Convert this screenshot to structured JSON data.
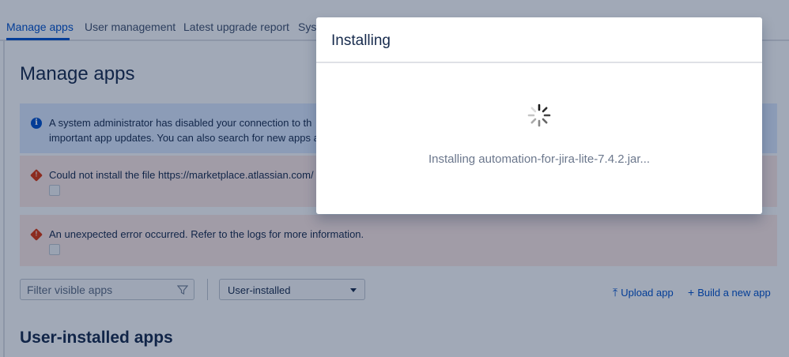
{
  "tabs": [
    {
      "label": "Manage apps"
    },
    {
      "label": "User management"
    },
    {
      "label": "Latest upgrade report"
    },
    {
      "label": "Syst"
    }
  ],
  "page": {
    "title": "Manage apps"
  },
  "messages": {
    "info_line1": "A system administrator has disabled your connection to th",
    "info_line2": "important app updates. You can also search for new apps a",
    "error1": "Could not install the file https://marketplace.atlassian.com/",
    "error2": "An unexpected error occurred. Refer to the logs for more information."
  },
  "toolbar": {
    "filter_placeholder": "Filter visible apps",
    "select_value": "User-installed",
    "upload_label": "Upload app",
    "build_label": "Build a new app"
  },
  "section": {
    "title": "User-installed apps"
  },
  "modal": {
    "title": "Installing",
    "status_text": "Installing automation-for-jira-lite-7.4.2.jar..."
  },
  "colors": {
    "accent": "#0052cc",
    "error": "#de350b",
    "info_bg": "#deebff",
    "error_bg": "#ffebe6"
  },
  "icons": [
    "info-icon",
    "error-icon",
    "filter-icon",
    "caret-down-icon",
    "upload-icon",
    "plus-icon",
    "spinner-icon"
  ]
}
